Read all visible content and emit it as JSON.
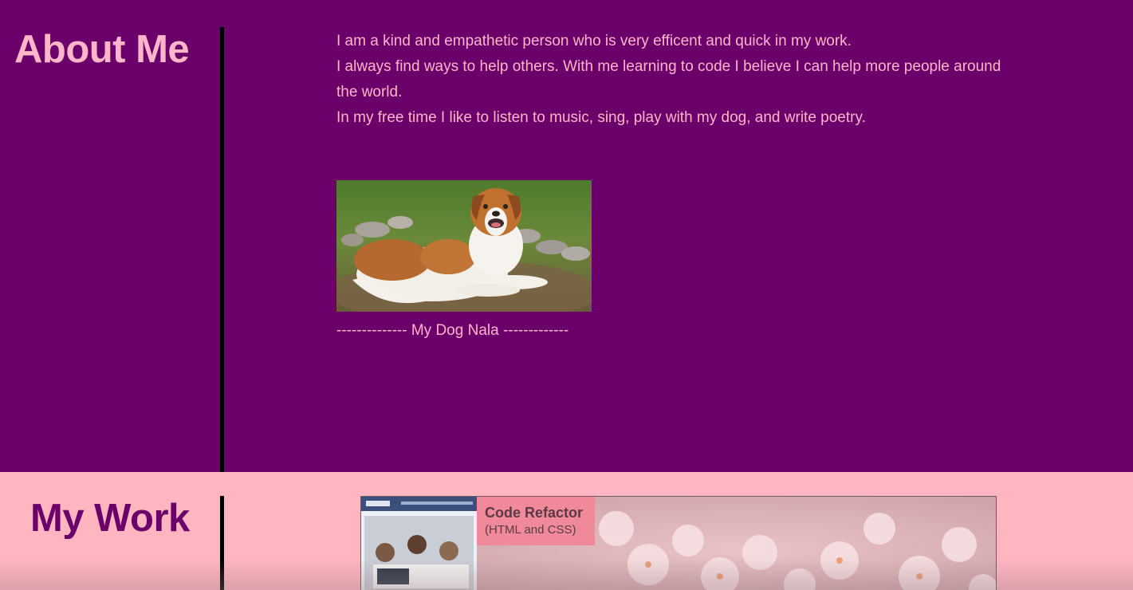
{
  "about": {
    "title": "About Me",
    "paragraphs": [
      "I am a kind and empathetic person who is very efficent and quick in my work.",
      "I always find ways to help others. With me learning to code I believe I can help more people around the world.",
      "In my free time I like to listen to music, sing, play with my dog, and write poetry."
    ],
    "photo_caption": "-------------- My Dog Nala -------------"
  },
  "work": {
    "title": "My Work",
    "projects": [
      {
        "title": "Code Refactor",
        "subtitle": "(HTML and CSS)"
      }
    ]
  },
  "colors": {
    "about_bg": "#6b006b",
    "about_text": "#ffb6c9",
    "work_bg": "#ffb6c1",
    "work_title": "#6b006b",
    "card_label_bg": "#f08a9a"
  }
}
